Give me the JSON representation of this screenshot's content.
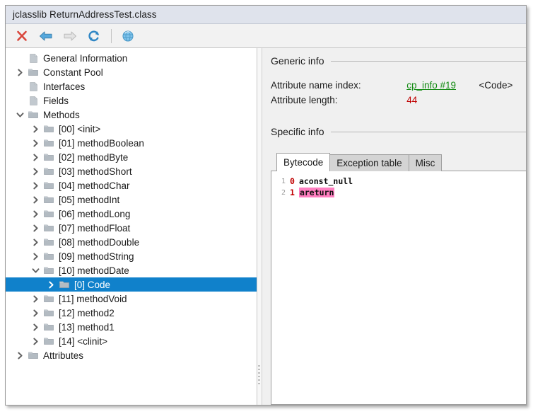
{
  "window": {
    "title": "jclasslib ReturnAddressTest.class"
  },
  "toolbar": {
    "buttons": [
      {
        "name": "close-icon",
        "label": "Close",
        "enabled": true
      },
      {
        "name": "back-arrow-icon",
        "label": "Backward",
        "enabled": true
      },
      {
        "name": "forward-arrow-icon",
        "label": "Forward",
        "enabled": false
      },
      {
        "name": "reload-icon",
        "label": "Reload",
        "enabled": true
      },
      {
        "name": "globe-icon",
        "label": "Browse classpath",
        "enabled": true
      }
    ]
  },
  "tree": {
    "items": [
      {
        "label": "General Information",
        "depth": 0,
        "icon": "document",
        "twisty": "none",
        "selected": false
      },
      {
        "label": "Constant Pool",
        "depth": 0,
        "icon": "folder",
        "twisty": "collapsed",
        "selected": false
      },
      {
        "label": "Interfaces",
        "depth": 0,
        "icon": "document",
        "twisty": "none",
        "selected": false
      },
      {
        "label": "Fields",
        "depth": 0,
        "icon": "document",
        "twisty": "none",
        "selected": false
      },
      {
        "label": "Methods",
        "depth": 0,
        "icon": "folder",
        "twisty": "expanded",
        "selected": false
      },
      {
        "label": "[00] <init>",
        "depth": 1,
        "icon": "folder",
        "twisty": "collapsed",
        "selected": false
      },
      {
        "label": "[01] methodBoolean",
        "depth": 1,
        "icon": "folder",
        "twisty": "collapsed",
        "selected": false
      },
      {
        "label": "[02] methodByte",
        "depth": 1,
        "icon": "folder",
        "twisty": "collapsed",
        "selected": false
      },
      {
        "label": "[03] methodShort",
        "depth": 1,
        "icon": "folder",
        "twisty": "collapsed",
        "selected": false
      },
      {
        "label": "[04] methodChar",
        "depth": 1,
        "icon": "folder",
        "twisty": "collapsed",
        "selected": false
      },
      {
        "label": "[05] methodInt",
        "depth": 1,
        "icon": "folder",
        "twisty": "collapsed",
        "selected": false
      },
      {
        "label": "[06] methodLong",
        "depth": 1,
        "icon": "folder",
        "twisty": "collapsed",
        "selected": false
      },
      {
        "label": "[07] methodFloat",
        "depth": 1,
        "icon": "folder",
        "twisty": "collapsed",
        "selected": false
      },
      {
        "label": "[08] methodDouble",
        "depth": 1,
        "icon": "folder",
        "twisty": "collapsed",
        "selected": false
      },
      {
        "label": "[09] methodString",
        "depth": 1,
        "icon": "folder",
        "twisty": "collapsed",
        "selected": false
      },
      {
        "label": "[10] methodDate",
        "depth": 1,
        "icon": "folder",
        "twisty": "expanded",
        "selected": false
      },
      {
        "label": "[0] Code",
        "depth": 2,
        "icon": "folder",
        "twisty": "collapsed",
        "selected": true
      },
      {
        "label": "[11] methodVoid",
        "depth": 1,
        "icon": "folder",
        "twisty": "collapsed",
        "selected": false
      },
      {
        "label": "[12] method2",
        "depth": 1,
        "icon": "folder",
        "twisty": "collapsed",
        "selected": false
      },
      {
        "label": "[13] method1",
        "depth": 1,
        "icon": "folder",
        "twisty": "collapsed",
        "selected": false
      },
      {
        "label": "[14] <clinit>",
        "depth": 1,
        "icon": "folder",
        "twisty": "collapsed",
        "selected": false
      },
      {
        "label": "Attributes",
        "depth": 0,
        "icon": "folder",
        "twisty": "collapsed",
        "selected": false
      }
    ]
  },
  "detail": {
    "generic_info": {
      "heading": "Generic info",
      "rows": [
        {
          "key": "Attribute name index:",
          "value": "cp_info #19",
          "value_style": "link",
          "extra": "<Code>"
        },
        {
          "key": "Attribute length:",
          "value": "44",
          "value_style": "red",
          "extra": ""
        }
      ]
    },
    "specific_info": {
      "heading": "Specific info",
      "tabs": [
        {
          "label": "Bytecode",
          "active": true
        },
        {
          "label": "Exception table",
          "active": false
        },
        {
          "label": "Misc",
          "active": false
        }
      ],
      "bytecode": [
        {
          "line": "1",
          "offset": "0",
          "op": "aconst_null",
          "highlight": false
        },
        {
          "line": "2",
          "offset": "1",
          "op": "areturn",
          "highlight": true
        }
      ]
    }
  },
  "colors": {
    "selection": "#1081cb",
    "link_green": "#118a11",
    "value_red": "#c00000",
    "highlight_pink": "#ff7fc0",
    "titlebar": "#dfe3ec"
  }
}
